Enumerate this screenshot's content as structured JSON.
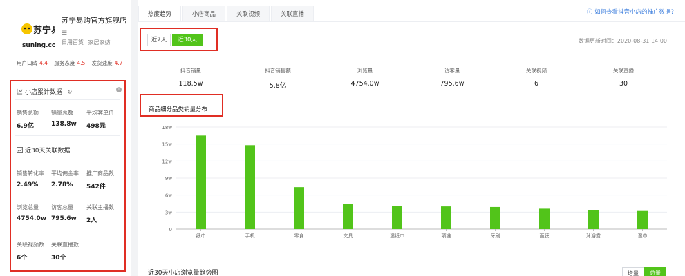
{
  "shop": {
    "logo_text": "苏宁易购",
    "logo_sub": "suning.com",
    "name": "苏宁易购官方旗舰店",
    "categories": [
      "日用百货",
      "家居家纺"
    ],
    "ratings": [
      {
        "label": "用户口碑",
        "value": "4.4"
      },
      {
        "label": "服务态度",
        "value": "4.5"
      },
      {
        "label": "发货速度",
        "value": "4.7"
      }
    ]
  },
  "cumulative": {
    "title": "小店累计数据",
    "metrics": [
      {
        "label": "销售总额",
        "value": "6.9亿"
      },
      {
        "label": "销量总数",
        "value": "138.8w"
      },
      {
        "label": "平均客单价",
        "value": "498元"
      }
    ]
  },
  "recent": {
    "title": "近30天关联数据",
    "rows": [
      [
        {
          "label": "销售转化率",
          "value": "2.49%"
        },
        {
          "label": "平均佣金率",
          "value": "2.78%"
        },
        {
          "label": "推广商品数",
          "value": "542件"
        }
      ],
      [
        {
          "label": "浏览总量",
          "value": "4754.0w"
        },
        {
          "label": "访客总量",
          "value": "795.6w"
        },
        {
          "label": "关联主播数",
          "value": "2人"
        }
      ],
      [
        {
          "label": "关联视频数",
          "value": "6个"
        },
        {
          "label": "关联直播数",
          "value": "30个"
        }
      ]
    ]
  },
  "tabs": [
    "热度趋势",
    "小店商品",
    "关联视频",
    "关联直播"
  ],
  "help_link": "如何查看抖音小店的推广数据?",
  "range": {
    "d7": "近7天",
    "d30": "近30天"
  },
  "update_time": "数据更新时间：2020-08-31 14:00",
  "kpis": [
    {
      "label": "抖音销量",
      "value": "118.5w"
    },
    {
      "label": "抖音销售额",
      "value": "5.8亿"
    },
    {
      "label": "浏览量",
      "value": "4754.0w"
    },
    {
      "label": "访客量",
      "value": "795.6w"
    },
    {
      "label": "关联视频",
      "value": "6"
    },
    {
      "label": "关联直播",
      "value": "30"
    }
  ],
  "distribution_title": "商品细分品类销量分布",
  "trend_title": "近30天小店浏览量趋势图",
  "toggles": {
    "increment": "增量",
    "total": "总量"
  },
  "colors": {
    "accent": "#52c41a",
    "highlight_border": "#e02e24",
    "link": "#3b7ddd",
    "rating": "#e02e24"
  },
  "chart_data": {
    "type": "bar",
    "categories": [
      "纸巾",
      "手机",
      "零食",
      "文具",
      "湿纸巾",
      "项链",
      "牙刷",
      "面膜",
      "沐浴露",
      "湿巾"
    ],
    "values": [
      16.5,
      14.8,
      7.4,
      4.4,
      4.1,
      4.0,
      3.9,
      3.6,
      3.4,
      3.2
    ],
    "yticks": [
      "0",
      "3w",
      "6w",
      "9w",
      "12w",
      "15w",
      "18w"
    ],
    "ylim": [
      0,
      18
    ],
    "unit": "w",
    "grid": true,
    "color": "#52c41a"
  }
}
